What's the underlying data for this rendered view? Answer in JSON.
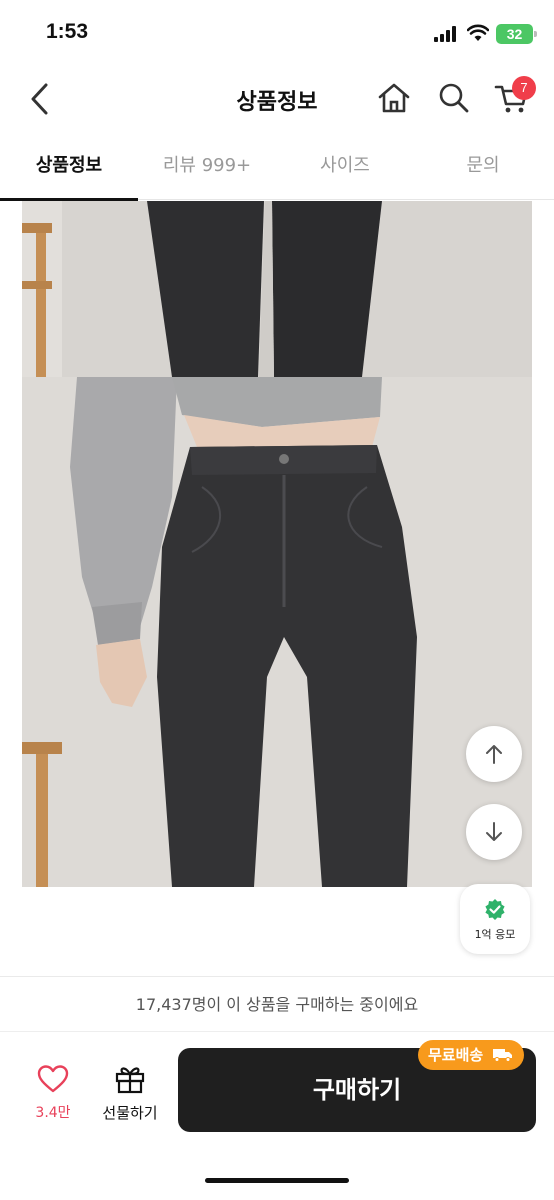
{
  "status_bar": {
    "time": "1:53",
    "battery": "32"
  },
  "header": {
    "title": "상품정보",
    "cart_count": "7",
    "icons": [
      "back-icon",
      "home-icon",
      "search-icon",
      "cart-icon"
    ]
  },
  "tabs": [
    {
      "label": "상품정보",
      "active": true
    },
    {
      "label": "리뷰 999+",
      "active": false
    },
    {
      "label": "사이즈",
      "active": false
    },
    {
      "label": "문의",
      "active": false
    }
  ],
  "floating": {
    "verify_label": "1억 응모",
    "verify_color": "#2fb26a"
  },
  "buyers_text": "17,437명이 이 상품을 구매하는 중이에요",
  "bottom_bar": {
    "like_count": "3.4만",
    "gift_label": "선물하기",
    "buy_label": "구매하기",
    "free_shipping": "무료배송",
    "accent_color": "#e8415a",
    "badge_color": "#f89a1c"
  }
}
